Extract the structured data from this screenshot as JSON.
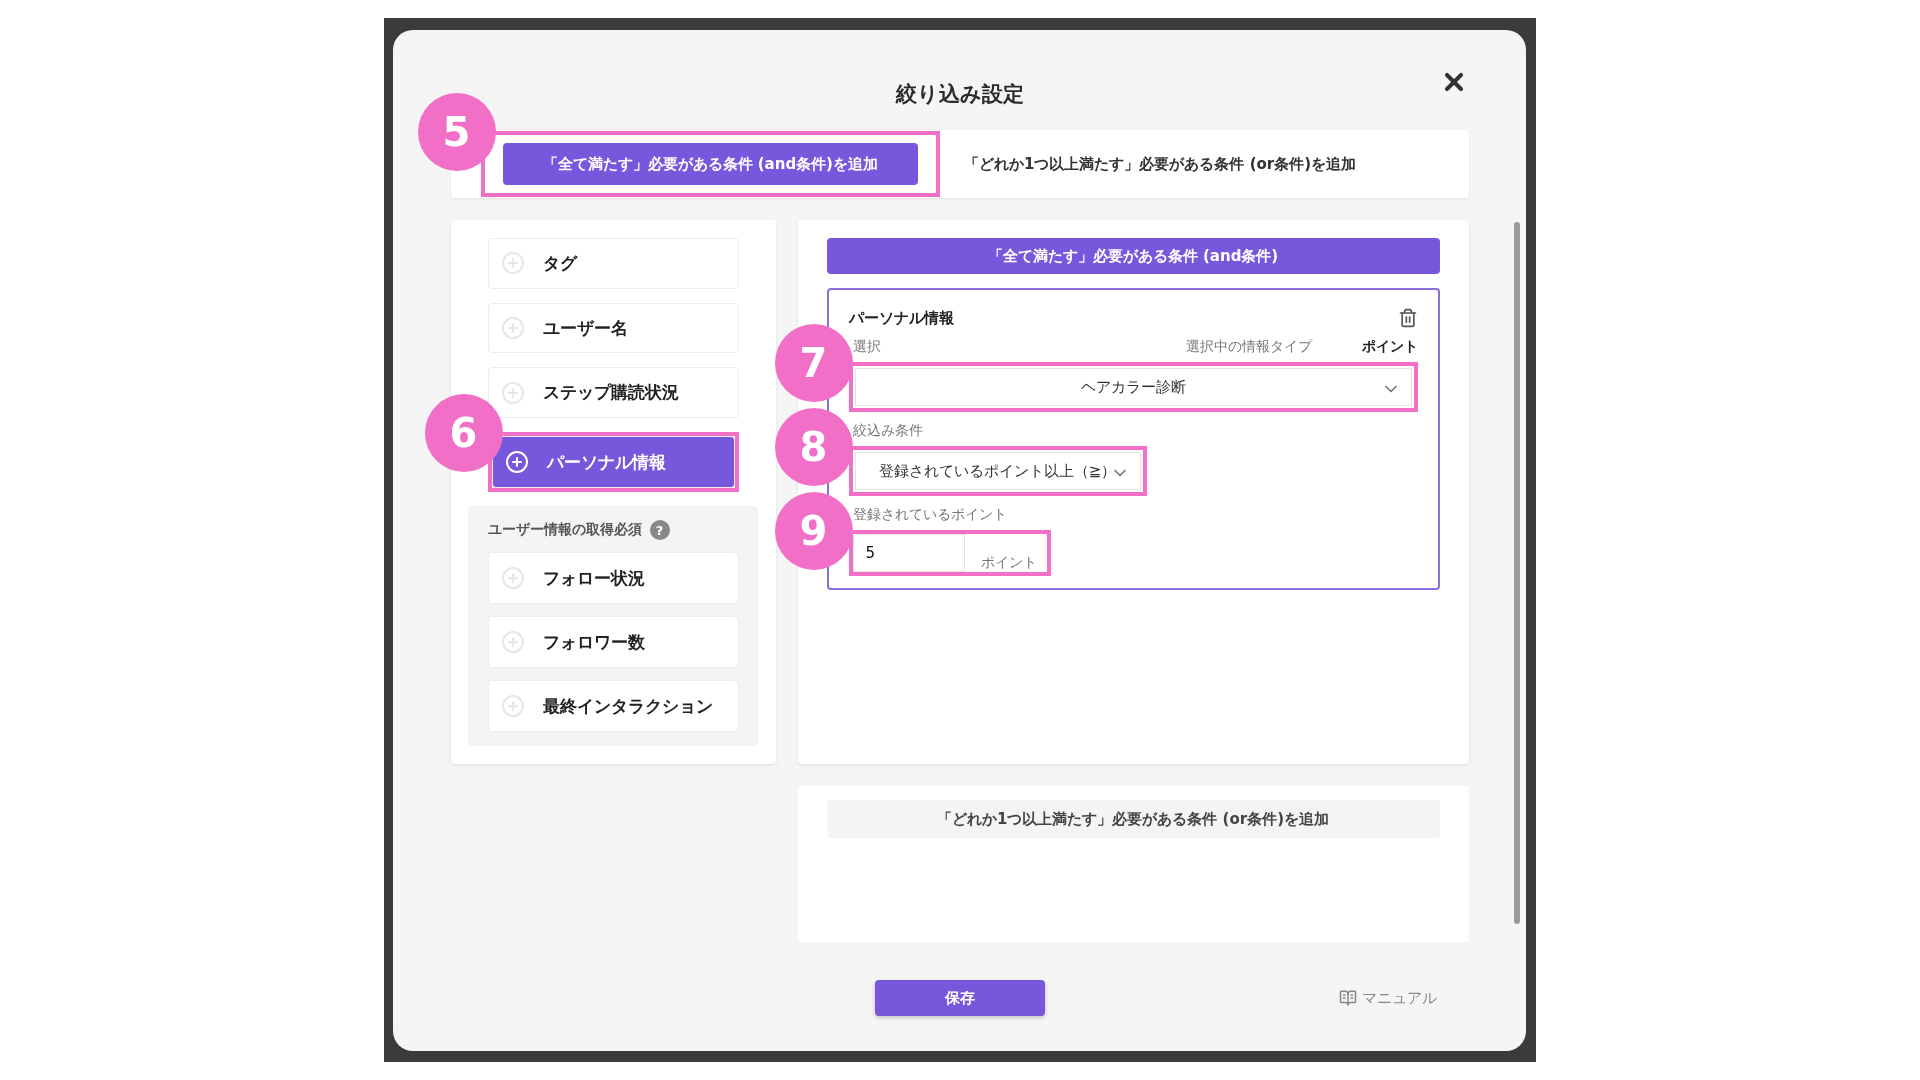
{
  "dialog": {
    "title": "絞り込み設定"
  },
  "mode_tabs": [
    {
      "label": "「全て満たす」必要がある条件 (and条件)を追加",
      "selected": true,
      "callout": "5"
    },
    {
      "label": "「どれか1つ以上満たす」必要がある条件 (or条件)を追加",
      "selected": false
    }
  ],
  "condition_types": [
    {
      "label": "タグ",
      "selected": false
    },
    {
      "label": "ユーザー名",
      "selected": false
    },
    {
      "label": "ステップ購読状況",
      "selected": false
    },
    {
      "label": "パーソナル情報",
      "selected": true,
      "callout": "6"
    }
  ],
  "required_group": {
    "title": "ユーザー情報の取得必須",
    "help": "?",
    "items": [
      {
        "label": "フォロー状況",
        "selected": false
      },
      {
        "label": "フォロワー数",
        "selected": false
      },
      {
        "label": "最終インタラクション",
        "selected": false
      }
    ]
  },
  "and_section": {
    "header": "「全て満たす」必要がある条件 (and条件)",
    "condition": {
      "title": "パーソナル情報",
      "select_label": "選択",
      "type_label": "選択中の情報タイプ",
      "type_value": "ポイント",
      "select": {
        "value": "ヘアカラー診断",
        "callout": "7"
      },
      "filter_label": "絞込み条件",
      "filter": {
        "value": "登録されているポイント以上（≧）",
        "callout": "8"
      },
      "points_label": "登録されているポイント",
      "points": {
        "value": "5",
        "unit": "ポイント",
        "callout": "9"
      }
    }
  },
  "or_section": {
    "button": "「どれか1つ以上満たす」必要がある条件 (or条件)を追加"
  },
  "footer": {
    "save": "保存",
    "manual": "マニュアル"
  }
}
